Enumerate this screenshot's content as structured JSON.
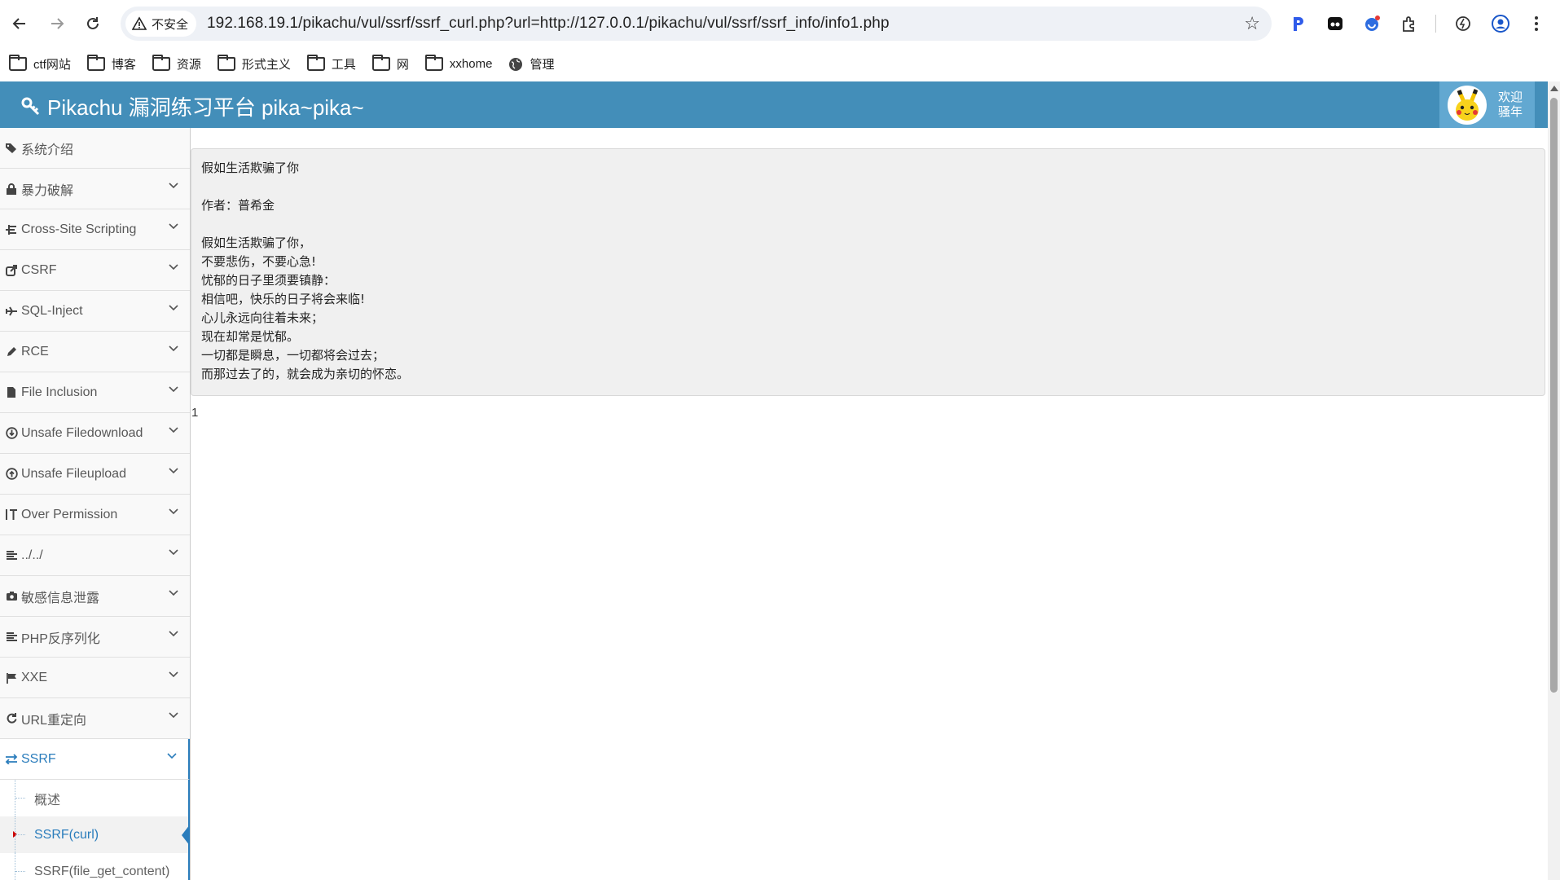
{
  "browser": {
    "security_label": "不安全",
    "url": "192.168.19.1/pikachu/vul/ssrf/ssrf_curl.php?url=http://127.0.0.1/pikachu/vul/ssrf/ssrf_info/info1.php",
    "bookmarks": [
      {
        "label": "ctf网站",
        "icon": "folder-icon"
      },
      {
        "label": "博客",
        "icon": "folder-icon"
      },
      {
        "label": "资源",
        "icon": "folder-icon"
      },
      {
        "label": "形式主义",
        "icon": "folder-icon"
      },
      {
        "label": "工具",
        "icon": "folder-icon"
      },
      {
        "label": "网",
        "icon": "folder-icon"
      },
      {
        "label": "xxhome",
        "icon": "folder-icon"
      },
      {
        "label": "管理",
        "icon": "globe-icon"
      }
    ]
  },
  "header": {
    "title": "Pikachu 漏洞练习平台 pika~pika~",
    "welcome_line1": "欢迎",
    "welcome_line2": "骚年",
    "bar_color": "#438eb9"
  },
  "sidebar": {
    "items": [
      {
        "label": "系统介绍",
        "icon": "tags-icon",
        "has_chevron": false
      },
      {
        "label": "暴力破解",
        "icon": "lock-icon",
        "has_chevron": true
      },
      {
        "label": "Cross-Site Scripting",
        "icon": "sitemap-icon",
        "has_chevron": true
      },
      {
        "label": "CSRF",
        "icon": "share-icon",
        "has_chevron": true
      },
      {
        "label": "SQL-Inject",
        "icon": "plane-icon",
        "has_chevron": true
      },
      {
        "label": "RCE",
        "icon": "pencil-icon",
        "has_chevron": true
      },
      {
        "label": "File Inclusion",
        "icon": "file-icon",
        "has_chevron": true
      },
      {
        "label": "Unsafe Filedownload",
        "icon": "download-icon",
        "has_chevron": true
      },
      {
        "label": "Unsafe Fileupload",
        "icon": "upload-icon",
        "has_chevron": true
      },
      {
        "label": "Over Permission",
        "icon": "text-height-icon",
        "has_chevron": true
      },
      {
        "label": "../../",
        "icon": "align-left-icon",
        "has_chevron": true
      },
      {
        "label": "敏感信息泄露",
        "icon": "camera-icon",
        "has_chevron": true
      },
      {
        "label": "PHP反序列化",
        "icon": "align-left-icon",
        "has_chevron": true
      },
      {
        "label": "XXE",
        "icon": "flag-icon",
        "has_chevron": true
      },
      {
        "label": "URL重定向",
        "icon": "refresh-icon",
        "has_chevron": true
      },
      {
        "label": "SSRF",
        "icon": "exchange-icon",
        "has_chevron": true,
        "active": true
      }
    ],
    "submenu": [
      {
        "label": "概述"
      },
      {
        "label": "SSRF(curl)",
        "active": true
      },
      {
        "label": "SSRF(file_get_content)"
      }
    ]
  },
  "main": {
    "lines": [
      "假如生活欺骗了你",
      "",
      "作者：普希金",
      "",
      "假如生活欺骗了你，",
      "不要悲伤，不要心急!",
      "忧郁的日子里须要镇静：",
      "相信吧，快乐的日子将会来临!",
      "心儿永远向往着未来；",
      "现在却常是忧郁。",
      "一切都是瞬息，一切都将会过去；",
      "而那过去了的，就会成为亲切的怀恋。"
    ],
    "trailing_text": "1"
  }
}
